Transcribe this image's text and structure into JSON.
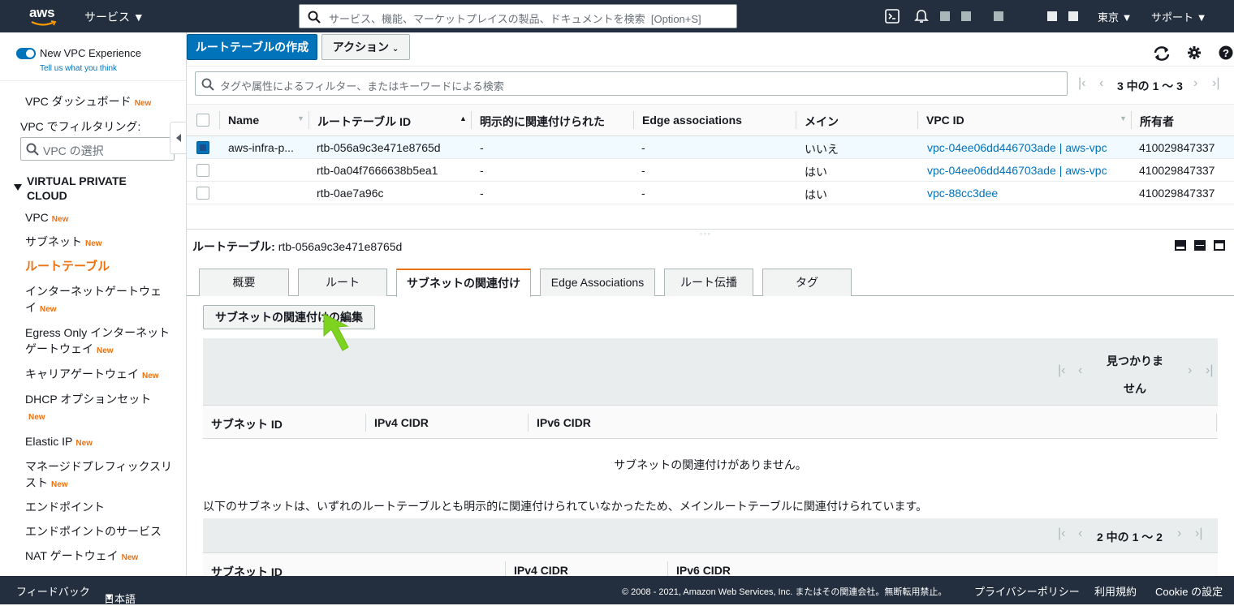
{
  "topbar": {
    "logo": "aws",
    "services": "サービス",
    "search_placeholder": "サービス、機能、マーケットプレイスの製品、ドキュメントを検索",
    "search_shortcut": "[Option+S]",
    "region": "東京",
    "support": "サポート"
  },
  "sidebar": {
    "new_vpc": "New VPC Experience",
    "tell_us": "Tell us what you think",
    "dashboard": "VPC ダッシュボード",
    "filter_label": "VPC でフィルタリング:",
    "vpc_select_placeholder": "VPC の選択",
    "section": "VIRTUAL PRIVATE CLOUD",
    "new_badge": "New",
    "items": [
      {
        "label": "VPC",
        "new": true
      },
      {
        "label": "サブネット",
        "new": true
      },
      {
        "label": "ルートテーブル",
        "new": false
      },
      {
        "label": "インターネットゲートウェイ",
        "new": true
      },
      {
        "label": "Egress Only インターネットゲートウェイ",
        "new": true
      },
      {
        "label": "キャリアゲートウェイ",
        "new": true
      },
      {
        "label": "DHCP オプションセット",
        "new": true
      },
      {
        "label": "Elastic IP",
        "new": true
      },
      {
        "label": "マネージドプレフィックスリスト",
        "new": true
      },
      {
        "label": "エンドポイント",
        "new": false
      },
      {
        "label": "エンドポイントのサービス",
        "new": false
      },
      {
        "label": "NAT ゲートウェイ",
        "new": true
      }
    ]
  },
  "toolbar": {
    "create": "ルートテーブルの作成",
    "actions": "アクション",
    "filter_placeholder": "タグや属性によるフィルター、またはキーワードによる検索",
    "pager": "3 中の 1 〜 3"
  },
  "route_table": {
    "columns": [
      "Name",
      "ルートテーブル ID",
      "明示的に関連付けられた",
      "Edge associations",
      "メイン",
      "VPC ID",
      "所有者"
    ],
    "rows": [
      {
        "name": "aws-infra-p...",
        "id": "rtb-056a9c3e471e8765d",
        "explicit": "-",
        "edge": "-",
        "main": "いいえ",
        "vpc": "vpc-04ee06dd446703ade | aws-vpc",
        "owner": "410029847337",
        "selected": true
      },
      {
        "name": "",
        "id": "rtb-0a04f7666638b5ea1",
        "explicit": "-",
        "edge": "-",
        "main": "はい",
        "vpc": "vpc-04ee06dd446703ade | aws-vpc",
        "owner": "410029847337",
        "selected": false
      },
      {
        "name": "",
        "id": "rtb-0ae7a96c",
        "explicit": "-",
        "edge": "-",
        "main": "はい",
        "vpc": "vpc-88cc3dee",
        "owner": "410029847337",
        "selected": false
      }
    ]
  },
  "detail": {
    "title_label": "ルートテーブル:",
    "title_value": "rtb-056a9c3e471e8765d",
    "tabs": [
      "概要",
      "ルート",
      "サブネットの関連付け",
      "Edge Associations",
      "ルート伝播",
      "タグ"
    ],
    "active_tab": "サブネットの関連付け",
    "edit_button": "サブネットの関連付けの編集",
    "not_found": "見つかりません",
    "subnet_columns": [
      "サブネット ID",
      "IPv4 CIDR",
      "IPv6 CIDR"
    ],
    "empty_message": "サブネットの関連付けがありません。",
    "notice": "以下のサブネットは、いずれのルートテーブルとも明示的に関連付けられていなかったため、メインルートテーブルに関連付けられています。",
    "pager2": "2 中の 1 〜 2",
    "subnet2_columns": [
      "サブネット ID",
      "IPv4 CIDR",
      "IPv6 CIDR"
    ]
  },
  "footer": {
    "feedback": "フィードバック",
    "language": "日本語",
    "copyright": "© 2008 - 2021, Amazon Web Services, Inc. またはその関連会社。無断転用禁止。",
    "privacy": "プライバシーポリシー",
    "terms": "利用規約",
    "cookie": "Cookie の設定"
  },
  "colors": {
    "accent": "#0073bb",
    "brand_orange": "#ec7211",
    "header_bg": "#232f3e",
    "cursor": "#7ed321"
  }
}
